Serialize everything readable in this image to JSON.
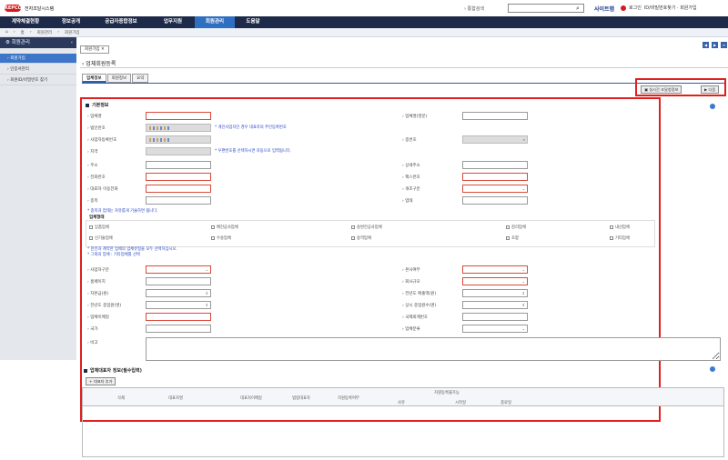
{
  "header": {
    "logo_mark": "KEPCO",
    "logo_text": "KEPCO",
    "logo_sub": "전자조달시스템",
    "search_label": "› 통합검색",
    "search_placeholder": "",
    "sitemap": "사이트맵",
    "login": "로그인",
    "links": "ID/비밀번호찾기 · 회원가입"
  },
  "gnb": [
    "계약체결현황",
    "정보공개",
    "공급자종합정보",
    "업무지원",
    "회원관리",
    "도움말"
  ],
  "gnb_active": 4,
  "breadcrumb": [
    "홈",
    "회원관리",
    "회원가입"
  ],
  "sidebar": {
    "title": "회원관리",
    "items": [
      {
        "label": "회원가입",
        "active": true
      },
      {
        "label": "인증서관리",
        "active": false
      },
      {
        "label": "회원ID/비밀번호 찾기",
        "active": false
      }
    ]
  },
  "page_tab": "회원가입 ✕",
  "page_title": "› 업체회원등록",
  "subtabs": [
    "업체정보",
    "회원정보",
    "요약"
  ],
  "toolbar": {
    "realtime": "실시간 조달청정보",
    "next": "▶ 다음"
  },
  "basic": {
    "title": "기본정보",
    "fields": {
      "company_name": "업체명",
      "company_name_en": "업체명(영문)",
      "corp_no": "법인번호",
      "corp_note": "* 개인사업자인 경우 대표자의 주민등록번호",
      "biz_no": "사업자등록번호",
      "branch_no": "종번호",
      "region": "지역",
      "region_note": "* 우편번호를 선택하시면 자동으로 입력됩니다.",
      "address": "주소",
      "address_detail": "상세주소",
      "phone": "전화번호",
      "fax": "팩스번호",
      "rep_mobile": "대표자 이동전화",
      "company_type": "개조구분",
      "item": "종목",
      "business": "업태",
      "item_note": "* 종목과 업태는 자유롭게 기술하면 됩니다."
    },
    "biz_type_title": "업체형태",
    "biz_types": [
      "납품업체",
      "배전공사업체",
      "송변전공사업체",
      "감리업체",
      "내선업체",
      "신기술업체",
      "수송업체",
      "용역업체",
      "조합",
      "기타업체"
    ],
    "biz_notes": [
      "* 한전과 계약한 업체의 업체유형을 모두 선택하십시오.",
      "* 그외의 업체 : 기타업체를 선택"
    ],
    "fields2": {
      "biz_class": "사업자구분",
      "hq": "본사여부",
      "homepage": "홈페이지",
      "size": "회사규모",
      "capital": "자본금(원)",
      "sales": "전년도 매출액(원)",
      "employees": "전년도 종업원(명)",
      "workers": "상시 종업원수(명)",
      "email": "업체이메일",
      "intl_no": "국제회계번호",
      "country": "국가",
      "category": "업체분류",
      "remark": "비고"
    }
  },
  "rep": {
    "title": "업체대표자 정보(필수입력)",
    "add_button": "+ 대표자 추가",
    "columns": [
      "삭제",
      "대표자명",
      "대표자이메일",
      "법정대표자",
      "지원등록여부",
      "지원등록불가능"
    ],
    "subcolumns": [
      "사유",
      "시작일",
      "종료일"
    ]
  }
}
